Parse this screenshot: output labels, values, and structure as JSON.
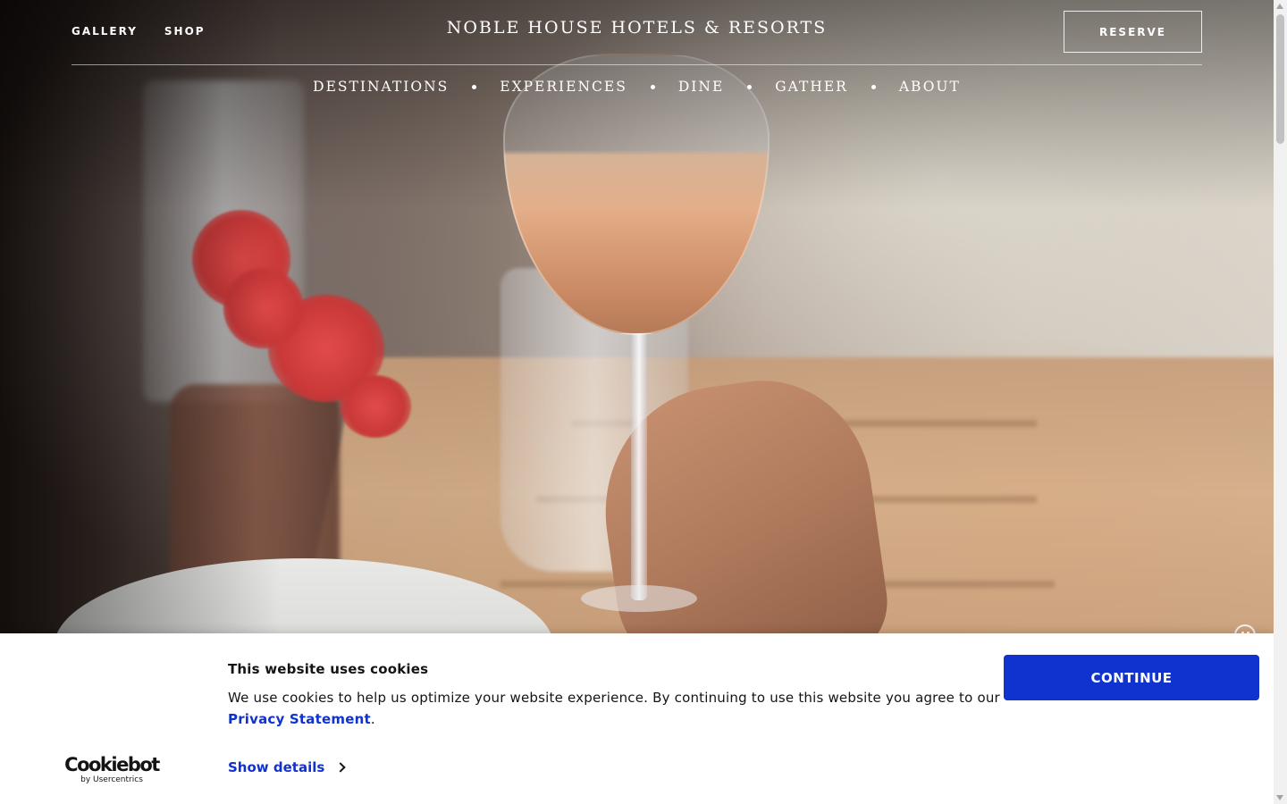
{
  "header": {
    "utility_links": [
      "GALLERY",
      "SHOP"
    ],
    "brand": "NOBLE HOUSE HOTELS & RESORTS",
    "reserve_label": "RESERVE",
    "main_nav": [
      "DESTINATIONS",
      "EXPERIENCES",
      "DINE",
      "GATHER",
      "ABOUT"
    ]
  },
  "hero": {
    "media": "video",
    "video_control_icon": "pause-icon"
  },
  "cookie_banner": {
    "logo_name": "Cookiebot",
    "logo_sub": "by Usercentrics",
    "title": "This website uses cookies",
    "body_prefix": "We use cookies to help us optimize your website experience. By continuing to use this website you agree to our ",
    "link_text": "Privacy Statement",
    "body_suffix": ".",
    "show_details_label": "Show details",
    "show_details_icon": "chevron-right-icon",
    "continue_label": "CONTINUE"
  },
  "colors": {
    "accent": "#1032CF",
    "banner_background": "#FFFFFF",
    "header_text": "#FFFFFF",
    "body_text": "#141414"
  }
}
